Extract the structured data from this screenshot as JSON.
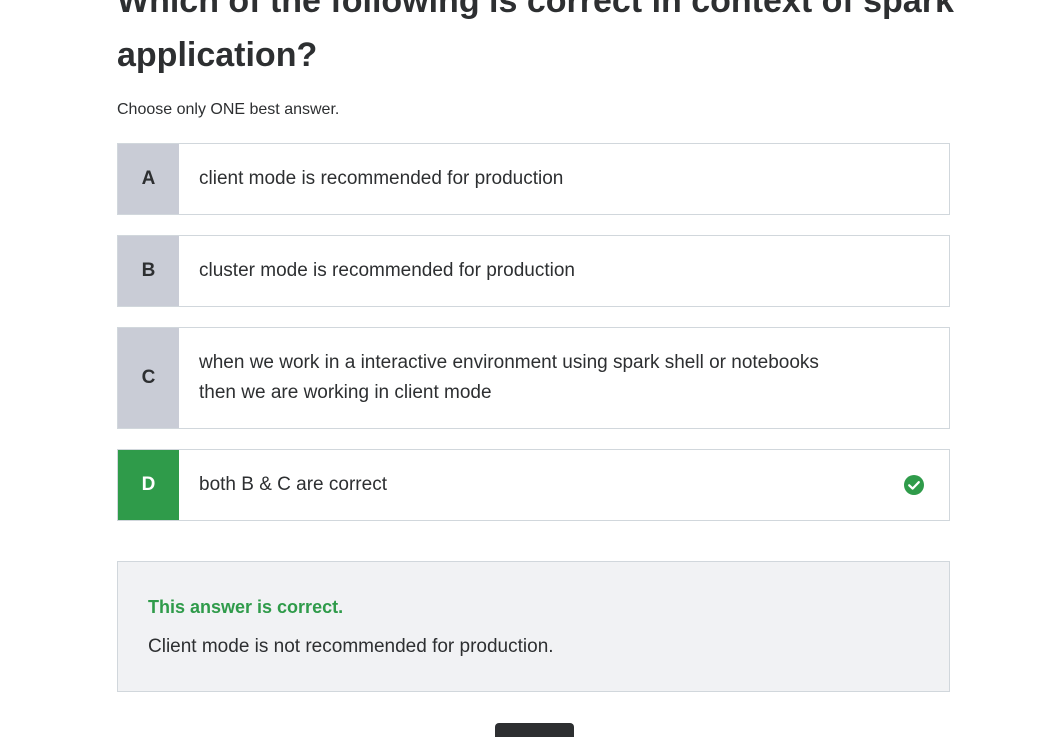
{
  "question": {
    "title": "Which of the following is correct in context of spark application?",
    "instructions": "Choose only ONE best answer."
  },
  "options": [
    {
      "letter": "A",
      "text": "client mode is recommended for production",
      "state": "default"
    },
    {
      "letter": "B",
      "text": "cluster mode is recommended for production",
      "state": "default"
    },
    {
      "letter": "C",
      "text": "when we work in a interactive environment using spark shell or notebooks then we are working in client mode",
      "state": "default"
    },
    {
      "letter": "D",
      "text": "both B & C are correct",
      "state": "correct"
    }
  ],
  "feedback": {
    "status": "This answer is correct.",
    "explanation": "Client mode is not recommended for production."
  },
  "icons": {
    "correct": "check-circle-icon"
  },
  "colors": {
    "correct": "#2f9b4a",
    "option_letter_bg": "#c9ccd6",
    "feedback_bg": "#f1f2f4",
    "text": "#2d2f31"
  }
}
